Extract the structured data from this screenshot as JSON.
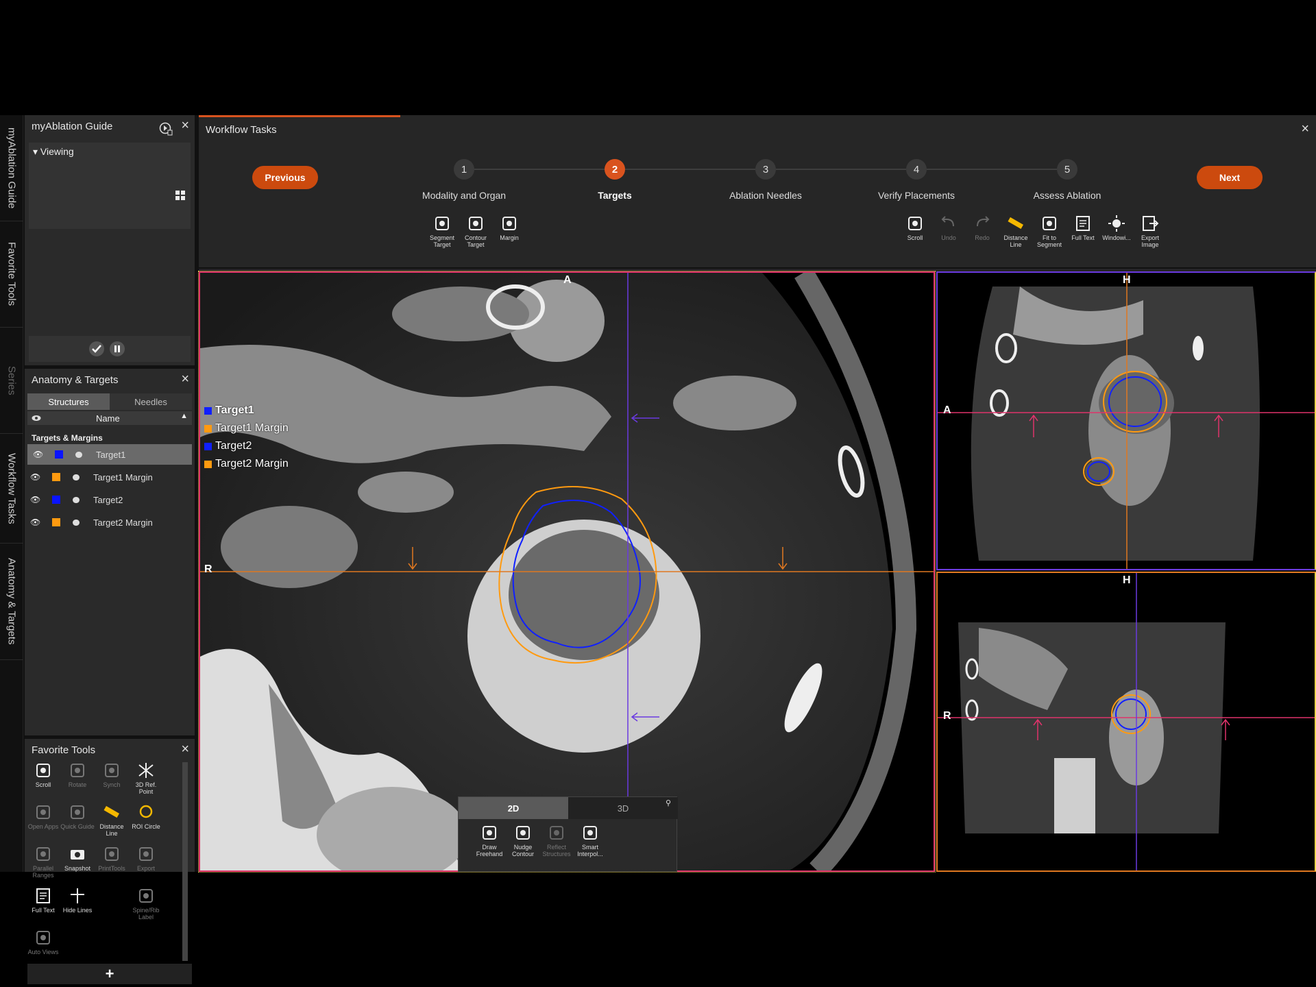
{
  "vtabs": [
    "myAblation Guide",
    "Favorite Tools",
    "Series",
    "Workflow Tasks",
    "Anatomy & Targets"
  ],
  "guide": {
    "title": "myAblation Guide",
    "section": "Viewing"
  },
  "anatomy": {
    "title": "Anatomy & Targets",
    "tabs": [
      "Structures",
      "Needles"
    ],
    "column": "Name",
    "group": "Targets & Margins",
    "rows": [
      {
        "label": "Target1",
        "color": "#0a14ff",
        "selected": true
      },
      {
        "label": "Target1 Margin",
        "color": "#ff9a10",
        "selected": false
      },
      {
        "label": "Target2",
        "color": "#0a14ff",
        "selected": false
      },
      {
        "label": "Target2 Margin",
        "color": "#ff9a10",
        "selected": false
      }
    ]
  },
  "fav": {
    "title": "Favorite Tools",
    "tools": [
      {
        "label": "Scroll",
        "icon": "scroll-icon",
        "enabled": true
      },
      {
        "label": "Rotate",
        "icon": "rotate-icon",
        "enabled": false
      },
      {
        "label": "Synch",
        "icon": "link-icon",
        "enabled": false
      },
      {
        "label": "3D Ref. Point",
        "icon": "ref-point-icon",
        "enabled": true
      },
      {
        "label": "Open Apps",
        "icon": "apps-icon",
        "enabled": false
      },
      {
        "label": "Quick Guide",
        "icon": "guide-icon",
        "enabled": false
      },
      {
        "label": "Distance Line",
        "icon": "ruler-icon",
        "enabled": true
      },
      {
        "label": "ROI Circle",
        "icon": "circle-icon",
        "enabled": true
      },
      {
        "label": "Parallel Ranges",
        "icon": "ranges-icon",
        "enabled": false
      },
      {
        "label": "Snapshot",
        "icon": "camera-icon",
        "enabled": true
      },
      {
        "label": "PrintTools",
        "icon": "print-icon",
        "enabled": false
      },
      {
        "label": "Export",
        "icon": "export-icon",
        "enabled": false
      },
      {
        "label": "Full Text",
        "icon": "text-icon",
        "enabled": true
      },
      {
        "label": "Hide Lines",
        "icon": "lines-icon",
        "enabled": true
      },
      {
        "label": "",
        "icon": "blank",
        "enabled": false
      },
      {
        "label": "Spine/Rib Label",
        "icon": "spine-icon",
        "enabled": false
      },
      {
        "label": "Auto Views",
        "icon": "autoview-icon",
        "enabled": false
      }
    ]
  },
  "workflow": {
    "title": "Workflow Tasks",
    "previous": "Previous",
    "next": "Next",
    "steps": [
      {
        "num": "1",
        "label": "Modality and Organ",
        "active": false
      },
      {
        "num": "2",
        "label": "Targets",
        "active": true
      },
      {
        "num": "3",
        "label": "Ablation Needles",
        "active": false
      },
      {
        "num": "4",
        "label": "Verify Placements",
        "active": false
      },
      {
        "num": "5",
        "label": "Assess Ablation",
        "active": false
      }
    ],
    "target_tools": [
      "Segment Target",
      "Contour Target",
      "Margin"
    ],
    "view_tools": [
      {
        "label": "Scroll",
        "enabled": true
      },
      {
        "label": "Undo",
        "enabled": false
      },
      {
        "label": "Redo",
        "enabled": false
      },
      {
        "label": "Distance Line",
        "enabled": true
      },
      {
        "label": "Fit to Segment",
        "enabled": true
      },
      {
        "label": "Full Text",
        "enabled": true
      },
      {
        "label": "Windowi...",
        "enabled": true
      },
      {
        "label": "Export Image",
        "enabled": true
      }
    ]
  },
  "viewer": {
    "legend": [
      {
        "label": "Target1",
        "color": "#1020ff",
        "bold": true
      },
      {
        "label": "Target1 Margin",
        "color": "#ff9a10",
        "bold": false
      },
      {
        "label": "Target2",
        "color": "#1020ff",
        "bold": false
      },
      {
        "label": "Target2 Margin",
        "color": "#ff9a10",
        "bold": false
      }
    ],
    "axial": {
      "top": "A",
      "left": "R"
    },
    "sagittal": {
      "top": "H",
      "left": "A"
    },
    "coronal": {
      "top": "H",
      "left": "R"
    }
  },
  "edit": {
    "tabs": [
      "2D",
      "3D"
    ],
    "tools": [
      {
        "label": "Draw Freehand",
        "enabled": true
      },
      {
        "label": "Nudge Contour",
        "enabled": true
      },
      {
        "label": "Reflect Structures",
        "enabled": false
      },
      {
        "label": "Smart Interpol...",
        "enabled": true
      }
    ]
  }
}
